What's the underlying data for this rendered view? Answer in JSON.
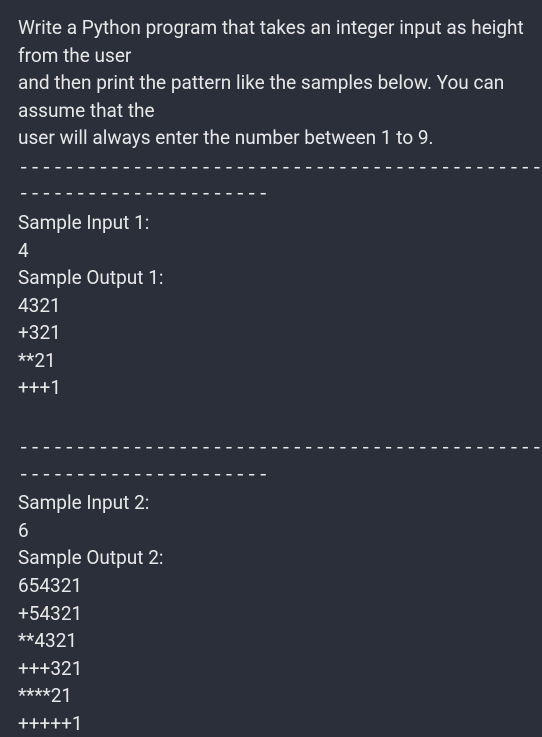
{
  "problem": {
    "line1": "Write a Python program that takes an integer input as height from the user",
    "line2": "and then print the pattern like the samples below. You can assume that the",
    "line3": "user will always enter the number between 1 to 9."
  },
  "separator1a": "-----------------------------------------------------",
  "separator1b": "----------------------",
  "sample1": {
    "input_label": "Sample Input 1:",
    "input_value": "4",
    "output_label": "Sample Output 1:",
    "output_lines": {
      "l1": "4321",
      "l2": "+321",
      "l3": "**21",
      "l4": "+++1"
    }
  },
  "separator2a": "-----------------------------------------------------",
  "separator2b": "----------------------",
  "sample2": {
    "input_label": "Sample Input 2:",
    "input_value": "6",
    "output_label": "Sample Output 2:",
    "output_lines": {
      "l1": "654321",
      "l2": "+54321",
      "l3": "**4321",
      "l4": "+++321",
      "l5": "****21",
      "l6": "+++++1"
    }
  }
}
